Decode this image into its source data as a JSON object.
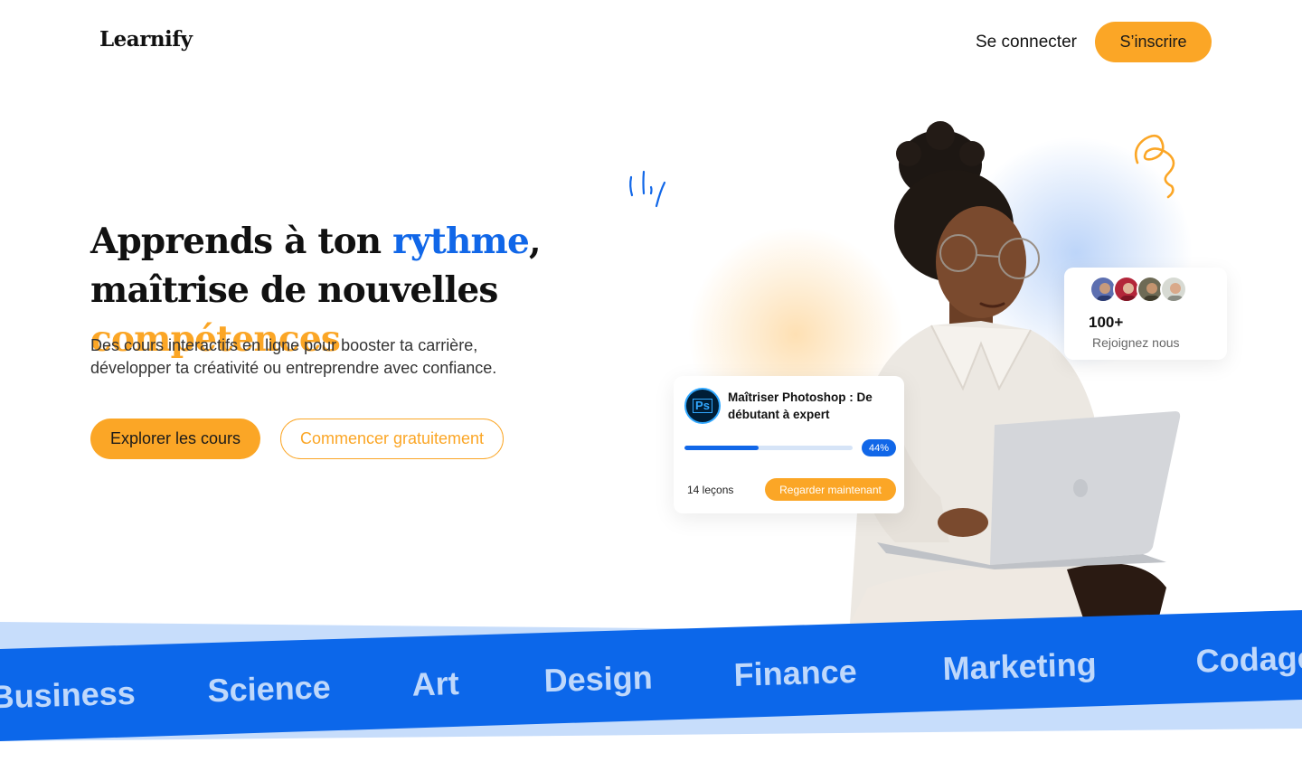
{
  "header": {
    "logo": "Learnify",
    "login_label": "Se connecter",
    "signup_label": "S’inscrire"
  },
  "hero": {
    "title_part1": "Apprends à ton ",
    "title_highlight1": "rythme",
    "title_part2": ", maîtrise de nouvelles ",
    "title_highlight2": "compétences",
    "subtitle_line1": "Des cours interactifs en ligne pour booster ta carrière,",
    "subtitle_line2": "développer ta créativité ou entreprendre avec confiance.",
    "primary_button": "Explorer les cours",
    "secondary_button": "Commencer gratuitement"
  },
  "community_card": {
    "count": "100+",
    "label": "Rejoignez nous"
  },
  "course_card": {
    "icon": "Ps",
    "title": "Maîtriser Photoshop : De débutant à expert",
    "progress_percent": 44,
    "progress_label": "44%",
    "lessons": "14 leçons",
    "watch_button": "Regarder maintenant"
  },
  "categories": [
    "Business",
    "Science",
    "Art",
    "Design",
    "Finance",
    "Marketing",
    "Codage"
  ],
  "colors": {
    "accent_orange": "#FBA626",
    "accent_blue": "#1167E8",
    "band_light": "#BFD8FB"
  }
}
